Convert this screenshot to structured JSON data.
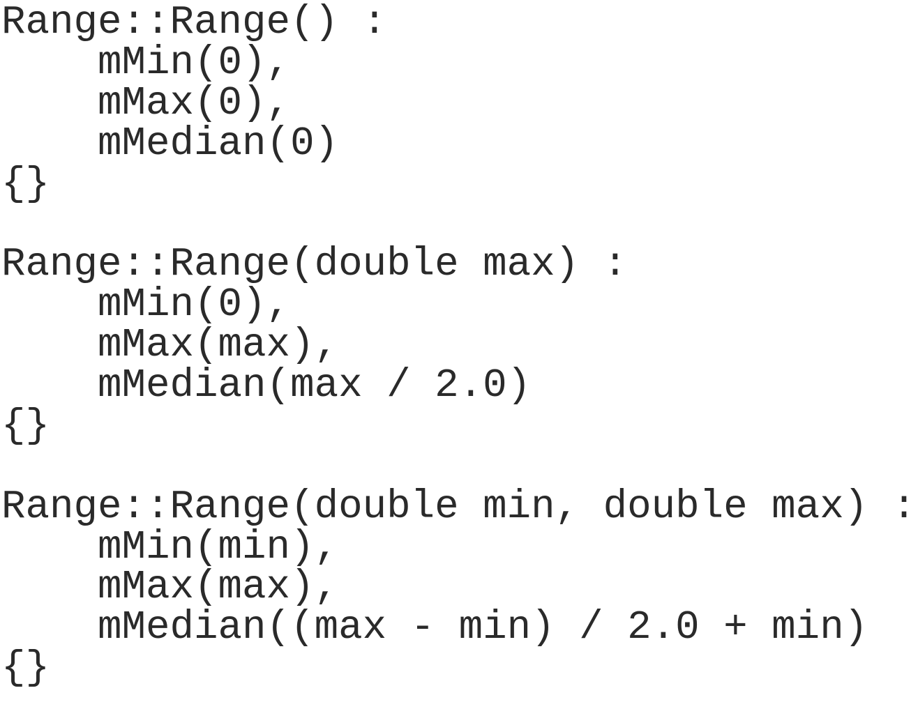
{
  "code": {
    "lines": [
      "Range::Range() :",
      "    mMin(0),",
      "    mMax(0),",
      "    mMedian(0)",
      "{}",
      "",
      "Range::Range(double max) :",
      "    mMin(0),",
      "    mMax(max),",
      "    mMedian(max / 2.0)",
      "{}",
      "",
      "Range::Range(double min, double max) :",
      "    mMin(min),",
      "    mMax(max),",
      "    mMedian((max - min) / 2.0 + min)",
      "{}"
    ]
  }
}
